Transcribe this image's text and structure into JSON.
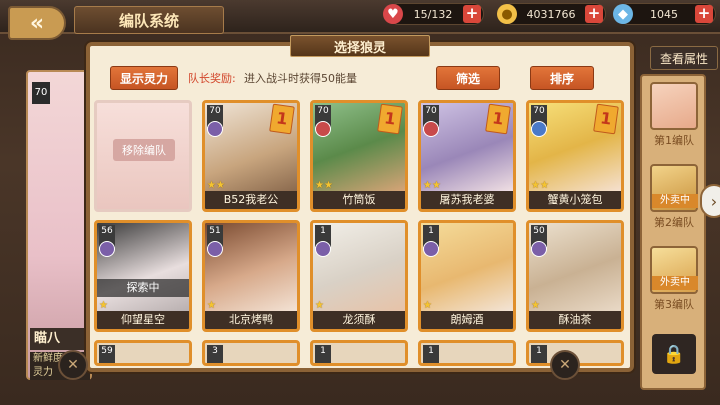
{
  "header": {
    "title": "编队系统",
    "back_icon": "double-chevron-left-icon",
    "resources": [
      {
        "icon": "heart-icon",
        "value": "15/132",
        "color": "#d9474a"
      },
      {
        "icon": "coin-icon",
        "value": "4031766",
        "color": "#f2c048"
      },
      {
        "icon": "crystal-icon",
        "value": "1045",
        "color": "#6cb6e6"
      }
    ]
  },
  "panel": {
    "title": "选择狼灵",
    "show_power_label": "显示灵力",
    "captain_label": "队长奖励:",
    "captain_text": "进入战斗时获得50能量",
    "filter_label": "筛选",
    "sort_label": "排序",
    "remove_label": "移除编队",
    "explore_label": "探索中"
  },
  "left_card": {
    "level": "70",
    "name": "瞄八",
    "info1": "新鲜度",
    "info2": "灵力"
  },
  "cards": [
    {
      "name": "",
      "level": "",
      "empty": true
    },
    {
      "name": "B52我老公",
      "level": "70",
      "badge": "1"
    },
    {
      "name": "竹筒饭",
      "level": "70",
      "badge": "1"
    },
    {
      "name": "屠苏我老婆",
      "level": "70",
      "badge": "1"
    },
    {
      "name": "蟹黄小笼包",
      "level": "70",
      "badge": "1"
    },
    {
      "name": "仰望星空",
      "level": "56",
      "exploring": true
    },
    {
      "name": "北京烤鸭",
      "level": "51"
    },
    {
      "name": "龙须酥",
      "level": "1"
    },
    {
      "name": "朗姆酒",
      "level": "1"
    },
    {
      "name": "酥油茶",
      "level": "50"
    },
    {
      "name": "",
      "level": "59"
    },
    {
      "name": "",
      "level": "3"
    },
    {
      "name": "",
      "level": "1"
    },
    {
      "name": "",
      "level": "1"
    },
    {
      "name": "",
      "level": "1"
    }
  ],
  "sidebar": {
    "attr_label": "查看属性",
    "teams": [
      {
        "label": "第1编队",
        "tag": ""
      },
      {
        "label": "第2编队",
        "tag": "外卖中"
      },
      {
        "label": "第3编队",
        "tag": "外卖中"
      }
    ],
    "lock_icon": "lock-icon",
    "arrow_icon": "chevron-right-icon"
  }
}
